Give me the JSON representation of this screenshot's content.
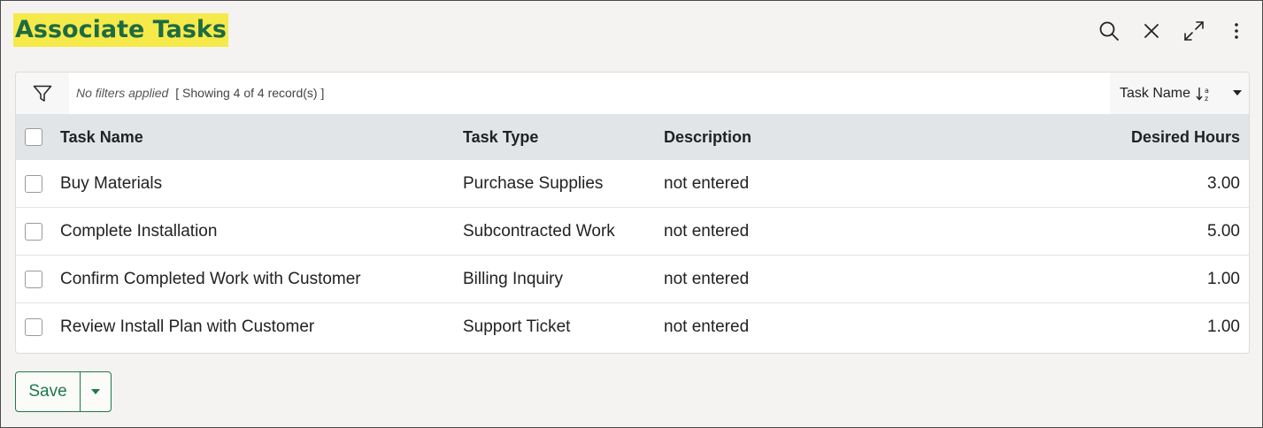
{
  "dialog": {
    "title": "Associate Tasks",
    "header_icons": [
      "search-icon",
      "close-icon",
      "expand-icon",
      "more-vertical-icon"
    ]
  },
  "filter": {
    "status": "No filters applied",
    "count": "[ Showing 4 of 4 record(s) ]",
    "icon": "filter-icon"
  },
  "sort": {
    "label": "Task Name",
    "icon": "sort-ascending-icon"
  },
  "table": {
    "columns": [
      "Task Name",
      "Task Type",
      "Description",
      "Desired Hours"
    ],
    "rows": [
      {
        "name": "Buy Materials",
        "type": "Purchase Supplies",
        "description": "not entered",
        "hours": "3.00"
      },
      {
        "name": "Complete Installation",
        "type": "Subcontracted Work",
        "description": "not entered",
        "hours": "5.00"
      },
      {
        "name": "Confirm Completed Work with Customer",
        "type": "Billing Inquiry",
        "description": "not entered",
        "hours": "1.00"
      },
      {
        "name": "Review Install Plan with Customer",
        "type": "Support Ticket",
        "description": "not entered",
        "hours": "1.00"
      }
    ]
  },
  "footer": {
    "save_label": "Save"
  },
  "colors": {
    "title_text": "#1d6b43",
    "title_highlight": "#f5ea4a",
    "accent": "#1d7a4a",
    "header_row": "#e2e5e8"
  }
}
